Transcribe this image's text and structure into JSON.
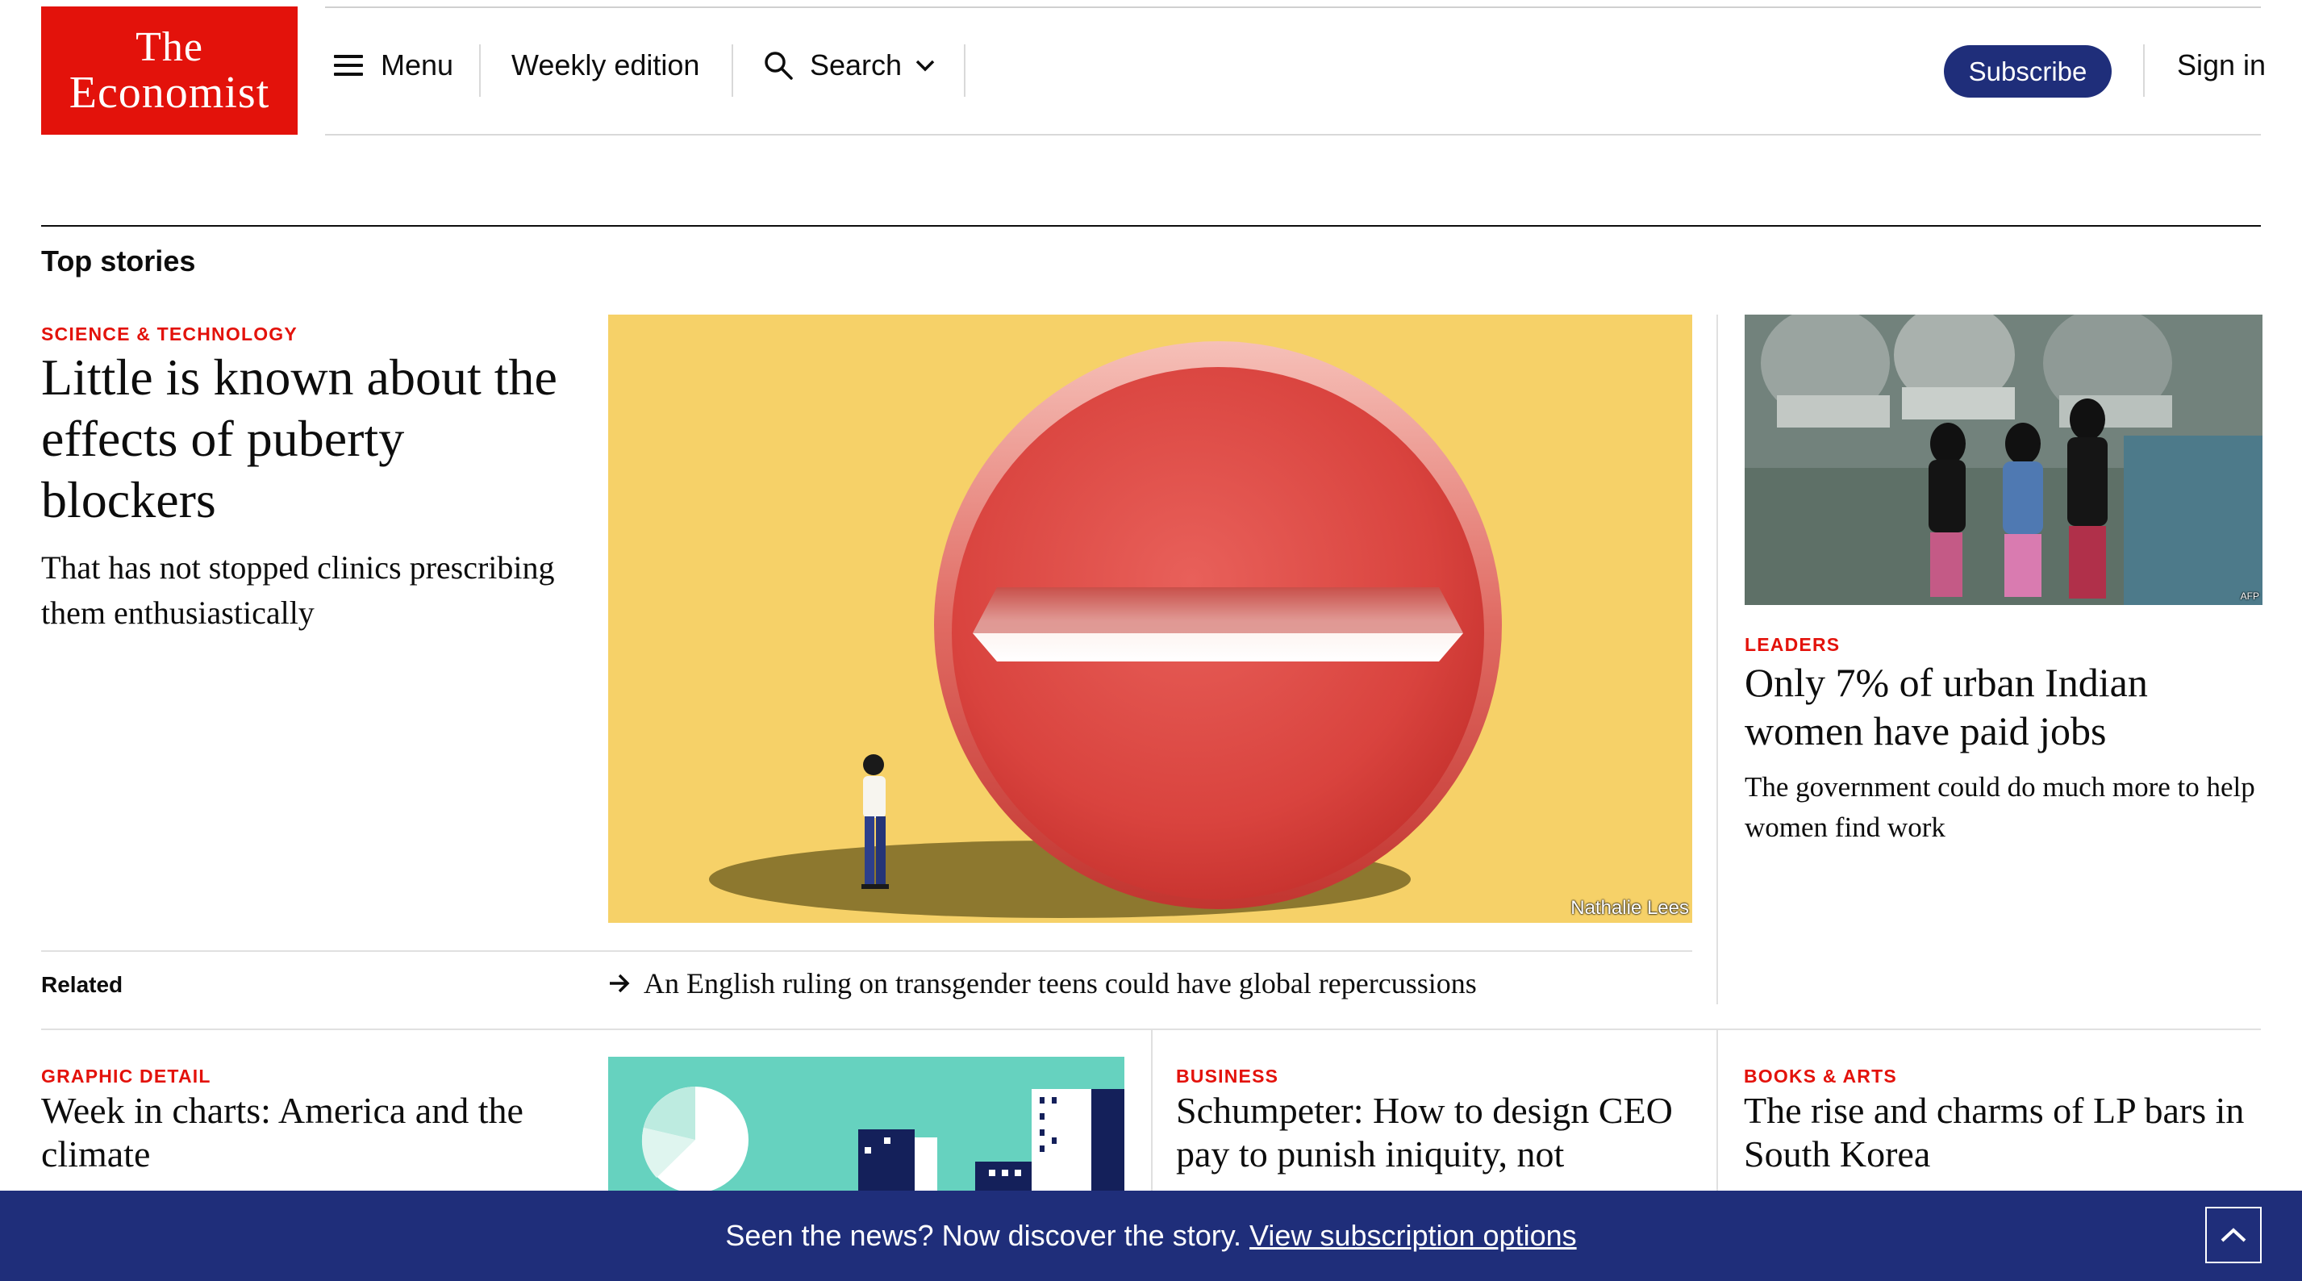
{
  "header": {
    "logo_line1": "The",
    "logo_line2": "Economist",
    "menu_label": "Menu",
    "weekly_label": "Weekly edition",
    "search_label": "Search",
    "subscribe_label": "Subscribe",
    "signin_label": "Sign in"
  },
  "top_stories": {
    "section_title": "Top stories",
    "lead": {
      "kicker": "Science & technology",
      "headline": "Little is known about the effects of puberty blockers",
      "rubric": "That has not stopped clinics prescribing them enthusiastically",
      "image_credit": "Nathalie Lees"
    },
    "side": {
      "kicker": "Leaders",
      "headline": "Only 7% of urban Indian women have paid jobs",
      "rubric": "The government could do much more to help women find work",
      "image_credit": "AFP"
    },
    "related": {
      "label": "Related",
      "link": "An English ruling on transgender teens could have global repercussions"
    }
  },
  "second_row": [
    {
      "kicker": "Graphic detail",
      "headline": "Week in charts: America and the climate"
    },
    {
      "kicker": "Business",
      "headline": "Schumpeter: How to design CEO pay to punish iniquity, not"
    },
    {
      "kicker": "Books & arts",
      "headline": "The rise and charms of LP bars in South Korea"
    }
  ],
  "banner": {
    "text": "Seen the news? Now discover the story.",
    "link": "View subscription options"
  },
  "colors": {
    "brand_red": "#e3120b",
    "navy": "#1f2e7a",
    "illustration_yellow": "#f6d168",
    "chart_teal": "#66d2bf"
  },
  "icons": [
    "menu-icon",
    "search-icon",
    "chevron-down-icon",
    "arrow-right-icon",
    "chevron-up-icon"
  ]
}
